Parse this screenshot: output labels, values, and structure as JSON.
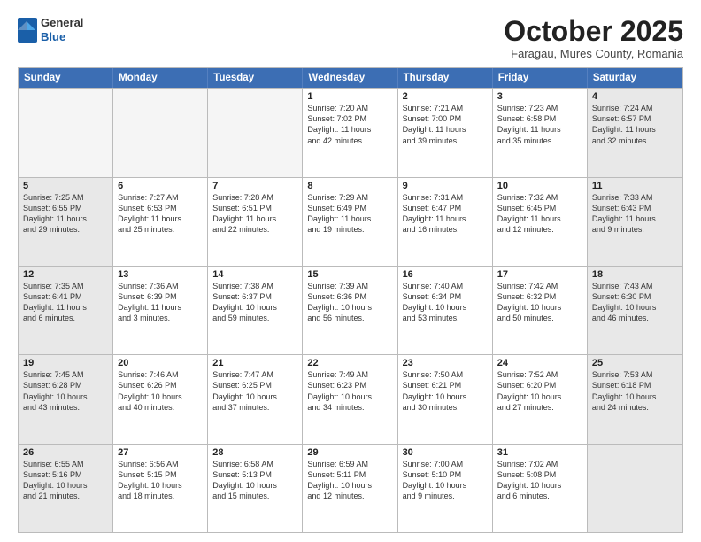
{
  "header": {
    "logo": {
      "general": "General",
      "blue": "Blue"
    },
    "title": "October 2025",
    "subtitle": "Faragau, Mures County, Romania"
  },
  "days": [
    "Sunday",
    "Monday",
    "Tuesday",
    "Wednesday",
    "Thursday",
    "Friday",
    "Saturday"
  ],
  "rows": [
    [
      {
        "day": "",
        "empty": true
      },
      {
        "day": "",
        "empty": true
      },
      {
        "day": "",
        "empty": true
      },
      {
        "day": "1",
        "line1": "Sunrise: 7:20 AM",
        "line2": "Sunset: 7:02 PM",
        "line3": "Daylight: 11 hours",
        "line4": "and 42 minutes."
      },
      {
        "day": "2",
        "line1": "Sunrise: 7:21 AM",
        "line2": "Sunset: 7:00 PM",
        "line3": "Daylight: 11 hours",
        "line4": "and 39 minutes."
      },
      {
        "day": "3",
        "line1": "Sunrise: 7:23 AM",
        "line2": "Sunset: 6:58 PM",
        "line3": "Daylight: 11 hours",
        "line4": "and 35 minutes."
      },
      {
        "day": "4",
        "line1": "Sunrise: 7:24 AM",
        "line2": "Sunset: 6:57 PM",
        "line3": "Daylight: 11 hours",
        "line4": "and 32 minutes.",
        "shaded": true
      }
    ],
    [
      {
        "day": "5",
        "line1": "Sunrise: 7:25 AM",
        "line2": "Sunset: 6:55 PM",
        "line3": "Daylight: 11 hours",
        "line4": "and 29 minutes.",
        "shaded": true
      },
      {
        "day": "6",
        "line1": "Sunrise: 7:27 AM",
        "line2": "Sunset: 6:53 PM",
        "line3": "Daylight: 11 hours",
        "line4": "and 25 minutes."
      },
      {
        "day": "7",
        "line1": "Sunrise: 7:28 AM",
        "line2": "Sunset: 6:51 PM",
        "line3": "Daylight: 11 hours",
        "line4": "and 22 minutes."
      },
      {
        "day": "8",
        "line1": "Sunrise: 7:29 AM",
        "line2": "Sunset: 6:49 PM",
        "line3": "Daylight: 11 hours",
        "line4": "and 19 minutes."
      },
      {
        "day": "9",
        "line1": "Sunrise: 7:31 AM",
        "line2": "Sunset: 6:47 PM",
        "line3": "Daylight: 11 hours",
        "line4": "and 16 minutes."
      },
      {
        "day": "10",
        "line1": "Sunrise: 7:32 AM",
        "line2": "Sunset: 6:45 PM",
        "line3": "Daylight: 11 hours",
        "line4": "and 12 minutes."
      },
      {
        "day": "11",
        "line1": "Sunrise: 7:33 AM",
        "line2": "Sunset: 6:43 PM",
        "line3": "Daylight: 11 hours",
        "line4": "and 9 minutes.",
        "shaded": true
      }
    ],
    [
      {
        "day": "12",
        "line1": "Sunrise: 7:35 AM",
        "line2": "Sunset: 6:41 PM",
        "line3": "Daylight: 11 hours",
        "line4": "and 6 minutes.",
        "shaded": true
      },
      {
        "day": "13",
        "line1": "Sunrise: 7:36 AM",
        "line2": "Sunset: 6:39 PM",
        "line3": "Daylight: 11 hours",
        "line4": "and 3 minutes."
      },
      {
        "day": "14",
        "line1": "Sunrise: 7:38 AM",
        "line2": "Sunset: 6:37 PM",
        "line3": "Daylight: 10 hours",
        "line4": "and 59 minutes."
      },
      {
        "day": "15",
        "line1": "Sunrise: 7:39 AM",
        "line2": "Sunset: 6:36 PM",
        "line3": "Daylight: 10 hours",
        "line4": "and 56 minutes."
      },
      {
        "day": "16",
        "line1": "Sunrise: 7:40 AM",
        "line2": "Sunset: 6:34 PM",
        "line3": "Daylight: 10 hours",
        "line4": "and 53 minutes."
      },
      {
        "day": "17",
        "line1": "Sunrise: 7:42 AM",
        "line2": "Sunset: 6:32 PM",
        "line3": "Daylight: 10 hours",
        "line4": "and 50 minutes."
      },
      {
        "day": "18",
        "line1": "Sunrise: 7:43 AM",
        "line2": "Sunset: 6:30 PM",
        "line3": "Daylight: 10 hours",
        "line4": "and 46 minutes.",
        "shaded": true
      }
    ],
    [
      {
        "day": "19",
        "line1": "Sunrise: 7:45 AM",
        "line2": "Sunset: 6:28 PM",
        "line3": "Daylight: 10 hours",
        "line4": "and 43 minutes.",
        "shaded": true
      },
      {
        "day": "20",
        "line1": "Sunrise: 7:46 AM",
        "line2": "Sunset: 6:26 PM",
        "line3": "Daylight: 10 hours",
        "line4": "and 40 minutes."
      },
      {
        "day": "21",
        "line1": "Sunrise: 7:47 AM",
        "line2": "Sunset: 6:25 PM",
        "line3": "Daylight: 10 hours",
        "line4": "and 37 minutes."
      },
      {
        "day": "22",
        "line1": "Sunrise: 7:49 AM",
        "line2": "Sunset: 6:23 PM",
        "line3": "Daylight: 10 hours",
        "line4": "and 34 minutes."
      },
      {
        "day": "23",
        "line1": "Sunrise: 7:50 AM",
        "line2": "Sunset: 6:21 PM",
        "line3": "Daylight: 10 hours",
        "line4": "and 30 minutes."
      },
      {
        "day": "24",
        "line1": "Sunrise: 7:52 AM",
        "line2": "Sunset: 6:20 PM",
        "line3": "Daylight: 10 hours",
        "line4": "and 27 minutes."
      },
      {
        "day": "25",
        "line1": "Sunrise: 7:53 AM",
        "line2": "Sunset: 6:18 PM",
        "line3": "Daylight: 10 hours",
        "line4": "and 24 minutes.",
        "shaded": true
      }
    ],
    [
      {
        "day": "26",
        "line1": "Sunrise: 6:55 AM",
        "line2": "Sunset: 5:16 PM",
        "line3": "Daylight: 10 hours",
        "line4": "and 21 minutes.",
        "shaded": true
      },
      {
        "day": "27",
        "line1": "Sunrise: 6:56 AM",
        "line2": "Sunset: 5:15 PM",
        "line3": "Daylight: 10 hours",
        "line4": "and 18 minutes."
      },
      {
        "day": "28",
        "line1": "Sunrise: 6:58 AM",
        "line2": "Sunset: 5:13 PM",
        "line3": "Daylight: 10 hours",
        "line4": "and 15 minutes."
      },
      {
        "day": "29",
        "line1": "Sunrise: 6:59 AM",
        "line2": "Sunset: 5:11 PM",
        "line3": "Daylight: 10 hours",
        "line4": "and 12 minutes."
      },
      {
        "day": "30",
        "line1": "Sunrise: 7:00 AM",
        "line2": "Sunset: 5:10 PM",
        "line3": "Daylight: 10 hours",
        "line4": "and 9 minutes."
      },
      {
        "day": "31",
        "line1": "Sunrise: 7:02 AM",
        "line2": "Sunset: 5:08 PM",
        "line3": "Daylight: 10 hours",
        "line4": "and 6 minutes."
      },
      {
        "day": "",
        "empty": true,
        "shaded": true
      }
    ]
  ]
}
